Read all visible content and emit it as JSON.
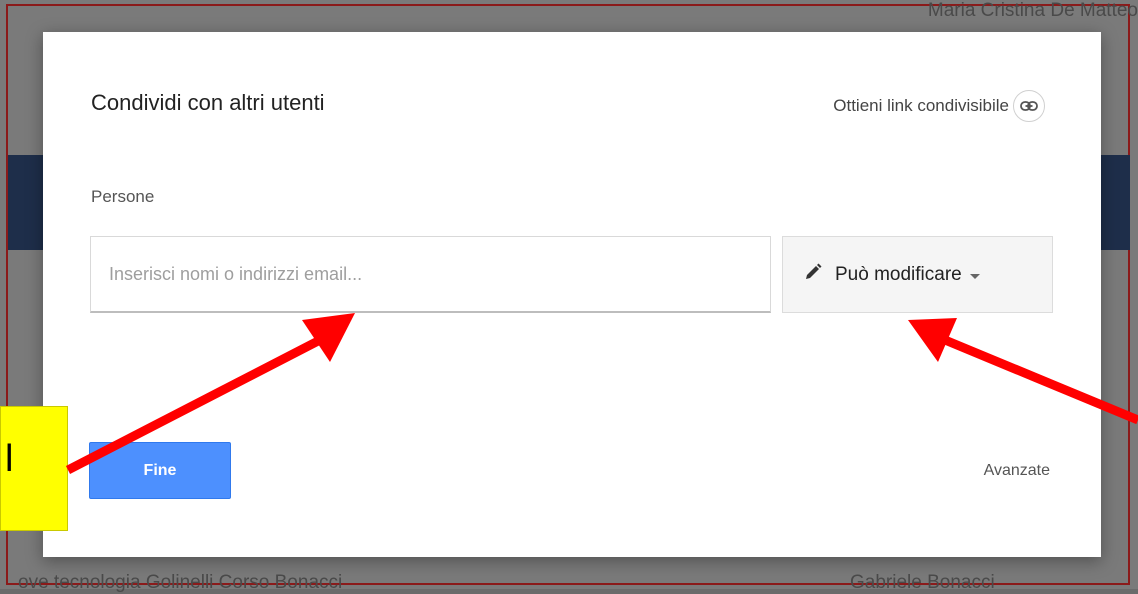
{
  "background": {
    "top_right_text": "Maria Cristina De Matteo",
    "bottom_left_text": "ove tecnologia Golinelli Corso Bonacci",
    "bottom_right_text": "Gabriele Bonacci"
  },
  "dialog": {
    "title": "Condividi con altri utenti",
    "share_link_label": "Ottieni link condivisibile",
    "people_label": "Persone",
    "email_placeholder": "Inserisci nomi o indirizzi email...",
    "permission_label": "Può modificare",
    "done_label": "Fine",
    "advanced_label": "Avanzate"
  },
  "annotation": {
    "callout_text": "l"
  },
  "colors": {
    "accent_blue": "#4d90fe",
    "arrow_red": "#ff0000",
    "callout_yellow": "#ffff00"
  },
  "icons": {
    "link": "link-icon",
    "pencil": "pencil-icon",
    "caret": "caret-down-icon"
  }
}
